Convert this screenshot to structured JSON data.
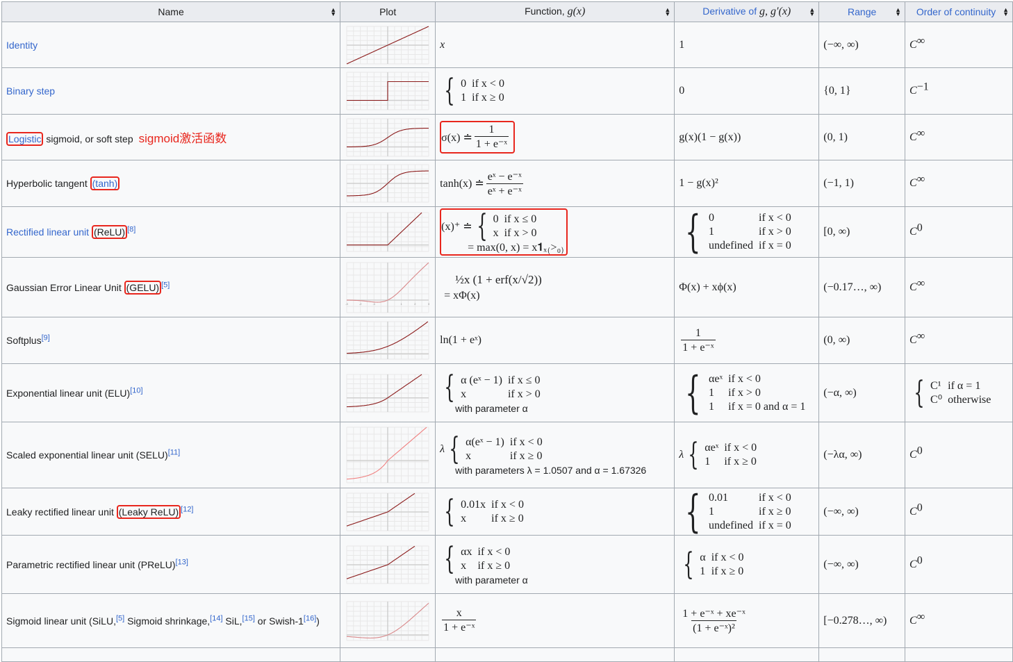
{
  "header": {
    "columns": [
      {
        "label": "Name",
        "sortable": true,
        "link": false
      },
      {
        "label": "Plot",
        "sortable": false,
        "link": false
      },
      {
        "label_prefix": "Function, ",
        "label_math": "g(x)",
        "sortable": true,
        "link": false
      },
      {
        "label_prefix": "Derivative of ",
        "label_math": "g, g′(x)",
        "sortable": true,
        "link": true
      },
      {
        "label": "Range",
        "sortable": true,
        "link": true
      },
      {
        "label": "Order of continuity",
        "sortable": true,
        "link": true
      }
    ],
    "sort_icon": "sort-updown-icon"
  },
  "annotation": {
    "text": "sigmoid激活函数",
    "color": "#e8261d"
  },
  "colors": {
    "link": "#3366cc",
    "highlight_box": "#e8261d",
    "plot_line": "#8b1a1a",
    "header_bg": "#eaecf0",
    "cell_bg": "#f8f9fa",
    "border": "#a2a9b1"
  },
  "rows": [
    {
      "name": "Identity",
      "function": "x",
      "derivative": "1",
      "range": "(−∞, ∞)",
      "continuity_base": "C",
      "continuity_sup": "∞"
    },
    {
      "name": "Binary step",
      "function_cases": [
        [
          "0",
          "if x < 0"
        ],
        [
          "1",
          "if x ≥ 0"
        ]
      ],
      "derivative": "0",
      "range": "{0, 1}",
      "continuity_base": "C",
      "continuity_sup": "−1"
    },
    {
      "name_link": "Logistic",
      "name_rest": " sigmoid, or soft step",
      "function_prefix": "σ(x) ≐",
      "function_num": "1",
      "function_den": "1 + e⁻ˣ",
      "derivative": "g(x)(1 − g(x))",
      "range": "(0, 1)",
      "continuity_base": "C",
      "continuity_sup": "∞"
    },
    {
      "name_prefix": "Hyperbolic tangent ",
      "name_link": "(tanh)",
      "function_prefix": "tanh(x) ≐",
      "function_num": "eˣ − e⁻ˣ",
      "function_den": "eˣ + e⁻ˣ",
      "derivative": "1 − g(x)²",
      "range": "(−1, 1)",
      "continuity_base": "C",
      "continuity_sup": "∞"
    },
    {
      "name_link": "Rectified linear unit",
      "name_box": "(ReLU)",
      "ref": "[8]",
      "function_prefix": "(x)⁺ ≐",
      "function_cases": [
        [
          "0",
          "if x ≤ 0"
        ],
        [
          "x",
          "if x > 0"
        ]
      ],
      "function_suffix": "= max(0, x) = x𝟏ₓ₍>₀₎",
      "derivative_cases": [
        [
          "0",
          "if x < 0"
        ],
        [
          "1",
          "if x > 0"
        ],
        [
          "undefined",
          "if x = 0"
        ]
      ],
      "range": "[0, ∞)",
      "continuity_base": "C",
      "continuity_sup": "0"
    },
    {
      "name_prefix": "Gaussian Error Linear Unit ",
      "name_box": "(GELU)",
      "ref": "[5]",
      "function_line1": "½x (1 + erf(x/√2))",
      "function_line2": "= xΦ(x)",
      "derivative": "Φ(x) + xϕ(x)",
      "range": "(−0.17…, ∞)",
      "continuity_base": "C",
      "continuity_sup": "∞"
    },
    {
      "name_prefix": "Softplus",
      "ref": "[9]",
      "function": "ln(1 + eˣ)",
      "derivative_num": "1",
      "derivative_den": "1 + e⁻ˣ",
      "range": "(0, ∞)",
      "continuity_base": "C",
      "continuity_sup": "∞"
    },
    {
      "name_prefix": "Exponential linear unit (ELU)",
      "ref": "[10]",
      "function_cases": [
        [
          "α (eˣ − 1)",
          "if x ≤ 0"
        ],
        [
          "x",
          "if x > 0"
        ]
      ],
      "function_note": "with parameter α",
      "derivative_cases": [
        [
          "αeˣ",
          "if x < 0"
        ],
        [
          "1",
          "if x > 0"
        ],
        [
          "1",
          "if x = 0 and α = 1"
        ]
      ],
      "range": "(−α, ∞)",
      "continuity_cases": [
        [
          "C¹",
          "if α = 1"
        ],
        [
          "C⁰",
          "otherwise"
        ]
      ]
    },
    {
      "name_prefix": "Scaled exponential linear unit (SELU)",
      "ref": "[11]",
      "function_prefix": "λ",
      "function_cases": [
        [
          "α(eˣ − 1)",
          "if x < 0"
        ],
        [
          "x",
          "if x ≥ 0"
        ]
      ],
      "function_note": "with parameters λ = 1.0507 and α = 1.67326",
      "derivative_prefix": "λ",
      "derivative_cases": [
        [
          "αeˣ",
          "if x < 0"
        ],
        [
          "1",
          "if x ≥ 0"
        ]
      ],
      "range": "(−λα, ∞)",
      "continuity_base": "C",
      "continuity_sup": "0"
    },
    {
      "name_prefix": "Leaky rectified linear unit ",
      "name_box": "(Leaky ReLU)",
      "ref": "[12]",
      "function_cases": [
        [
          "0.01x",
          "if x < 0"
        ],
        [
          "x",
          "if x ≥ 0"
        ]
      ],
      "derivative_cases": [
        [
          "0.01",
          "if x < 0"
        ],
        [
          "1",
          "if x ≥ 0"
        ],
        [
          "undefined",
          "if x = 0"
        ]
      ],
      "range": "(−∞, ∞)",
      "continuity_base": "C",
      "continuity_sup": "0"
    },
    {
      "name_prefix": "Parametric rectified linear unit (PReLU)",
      "ref": "[13]",
      "function_cases": [
        [
          "αx",
          "if x < 0"
        ],
        [
          "x",
          "if x ≥ 0"
        ]
      ],
      "function_note": "with parameter α",
      "derivative_cases": [
        [
          "α",
          "if x < 0"
        ],
        [
          "1",
          "if x ≥ 0"
        ]
      ],
      "range": "(−∞, ∞)",
      "continuity_base": "C",
      "continuity_sup": "0"
    },
    {
      "name_parts": [
        "Sigmoid linear unit (SiLU,",
        "[5]",
        " Sigmoid shrinkage,",
        "[14]",
        " SiL,",
        "[15]",
        " or Swish‐1",
        "[16]",
        ")"
      ],
      "function_num": "x",
      "function_den": "1 + e⁻ˣ",
      "derivative_num": "1 + e⁻ˣ + xe⁻ˣ",
      "derivative_den": "(1 + e⁻ˣ)²",
      "range": "[−0.278…, ∞)",
      "continuity_base": "C",
      "continuity_sup": "∞"
    }
  ],
  "plots": [
    {
      "function": "identity",
      "xlim": [
        -3,
        3
      ],
      "ylim": [
        -3,
        3
      ]
    },
    {
      "function": "binary_step",
      "xlim": [
        -3,
        3
      ],
      "ylim": [
        -0.5,
        1.5
      ]
    },
    {
      "function": "logistic",
      "xlim": [
        -6,
        6
      ],
      "ylim": [
        -0.5,
        1.5
      ]
    },
    {
      "function": "tanh",
      "xlim": [
        -3,
        3
      ],
      "ylim": [
        -1.5,
        1.5
      ]
    },
    {
      "function": "relu",
      "xlim": [
        -3,
        3
      ],
      "ylim": [
        -0.5,
        2.5
      ]
    },
    {
      "function": "gelu",
      "xlim": [
        -3,
        3
      ],
      "ylim": [
        -1,
        3
      ],
      "tick_labels": [
        "-3",
        "-2",
        "-1",
        "1",
        "2",
        "3"
      ]
    },
    {
      "function": "softplus",
      "xlim": [
        -3,
        3
      ],
      "ylim": [
        -0.5,
        3
      ]
    },
    {
      "function": "elu",
      "xlim": [
        -3,
        3
      ],
      "ylim": [
        -1.5,
        2.5
      ]
    },
    {
      "function": "selu",
      "xlim": [
        -3,
        3
      ],
      "ylim": [
        -2,
        3
      ]
    },
    {
      "function": "leaky_relu",
      "xlim": [
        -3,
        3
      ],
      "ylim": [
        -2,
        2
      ]
    },
    {
      "function": "prelu",
      "xlim": [
        -3,
        3
      ],
      "ylim": [
        -2,
        2
      ]
    },
    {
      "function": "silu",
      "xlim": [
        -3,
        3
      ],
      "ylim": [
        -0.5,
        3
      ]
    }
  ]
}
